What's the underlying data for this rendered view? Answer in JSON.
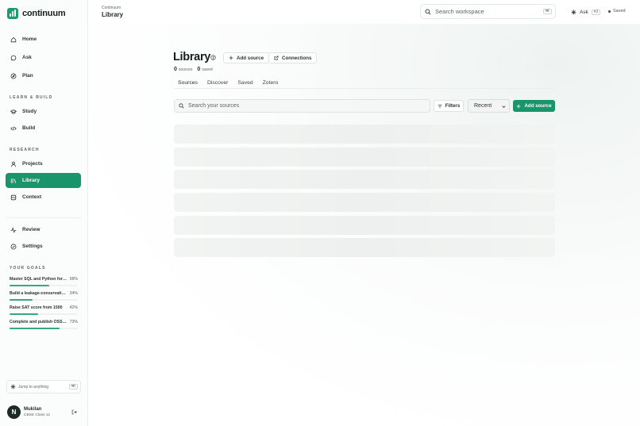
{
  "app": {
    "name": "continuum",
    "brand_color": "#1a946a"
  },
  "header": {
    "crumb": "Continuum",
    "title": "Library",
    "search_placeholder": "Search workspace",
    "search_shortcut": "⌘K",
    "ask_label": "Ask",
    "ask_shortcut": "⌘J",
    "save_status": "Saved"
  },
  "sidebar": {
    "nav_primary": [
      {
        "label": "Home",
        "icon": "home-icon"
      },
      {
        "label": "Ask",
        "icon": "chat-icon"
      },
      {
        "label": "Plan",
        "icon": "compass-icon"
      }
    ],
    "learn_title": "LEARN & BUILD",
    "learn_items": [
      {
        "label": "Study",
        "icon": "cap-icon"
      },
      {
        "label": "Build",
        "icon": "code-icon"
      }
    ],
    "research_title": "RESEARCH",
    "research_items": [
      {
        "label": "Projects",
        "icon": "person-icon"
      },
      {
        "label": "Library",
        "icon": "library-icon",
        "active": true
      },
      {
        "label": "Context",
        "icon": "database-icon"
      }
    ],
    "other_items": [
      {
        "label": "Review",
        "icon": "pulse-icon"
      },
      {
        "label": "Settings",
        "icon": "shield-icon"
      }
    ],
    "goals_title": "YOUR GOALS",
    "goals": [
      {
        "title": "Master SQL and Python for analytics",
        "pct_label": "58%",
        "progress": 0.58
      },
      {
        "title": "Build a leakage-conservative model",
        "pct_label": "34%",
        "progress": 0.34
      },
      {
        "title": "Raise SAT score from 1500",
        "pct_label": "42%",
        "progress": 0.42
      },
      {
        "title": "Complete and publish OSS project",
        "pct_label": "73%",
        "progress": 0.73
      }
    ],
    "jump_label": "Jump to anything",
    "jump_shortcut": "⌘K",
    "user": {
      "initial": "N",
      "name": "Mukilan",
      "subtitle": "CBSE Class 12"
    }
  },
  "main": {
    "title": "Library",
    "add_source_label": "Add source",
    "connections_label": "Connections",
    "stats": [
      {
        "count": "0",
        "label": "sources"
      },
      {
        "count": "0",
        "label": "saved"
      }
    ],
    "tabs": [
      "Sources",
      "Discover",
      "Saved",
      "Zotero"
    ],
    "active_tab": "Sources",
    "search_placeholder": "Search your sources",
    "filters_label": "Filters",
    "sort_value": "Recent",
    "add_source_primary": "Add source"
  }
}
